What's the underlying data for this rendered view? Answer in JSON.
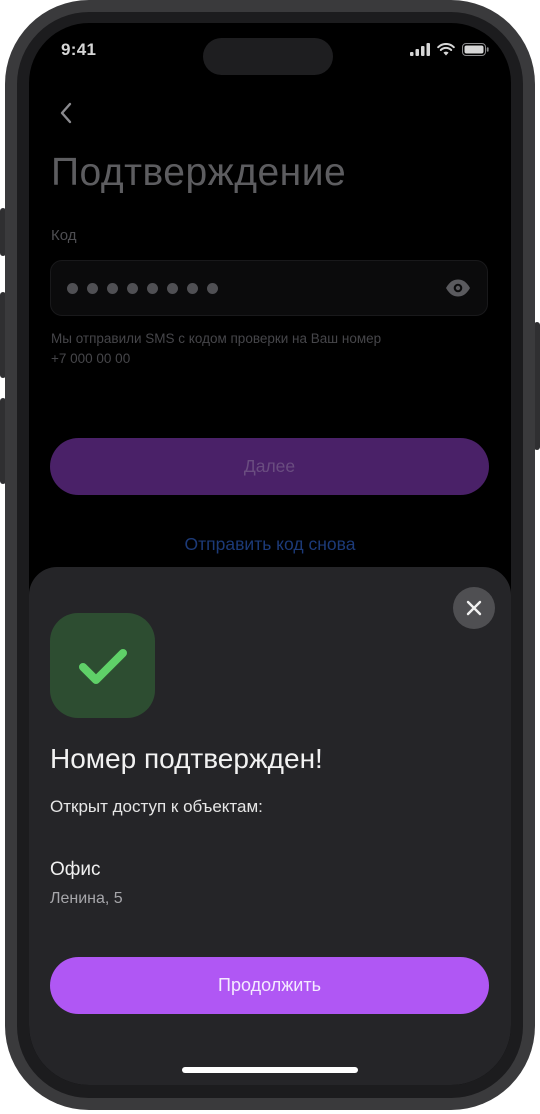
{
  "status_bar": {
    "time": "9:41"
  },
  "header": {
    "title": "Подтверждение"
  },
  "form": {
    "code_label": "Код",
    "code_value_mask": "••••••••",
    "hint_line1": "Мы отправили SMS с кодом проверки на Ваш номер",
    "hint_line2": "+7 000 00 00",
    "next_label": "Далее",
    "resend_label": "Отправить код снова"
  },
  "sheet": {
    "title": "Номер подтвержден!",
    "subtitle": "Открыт доступ к объектам:",
    "objects": [
      {
        "name": "Офис",
        "address": "Ленина, 5"
      }
    ],
    "continue_label": "Продолжить"
  },
  "icons": [
    "chevron-left-icon",
    "eye-icon",
    "close-icon",
    "checkmark-icon",
    "signal-icon",
    "wifi-icon",
    "battery-icon"
  ],
  "colors": {
    "accent": "#b057f4",
    "accent_dimmed": "#4a2168",
    "success_bg": "#2d4d31",
    "success_check": "#5fd068",
    "sheet_bg": "#252528",
    "link_dimmed": "#1c3a78"
  }
}
